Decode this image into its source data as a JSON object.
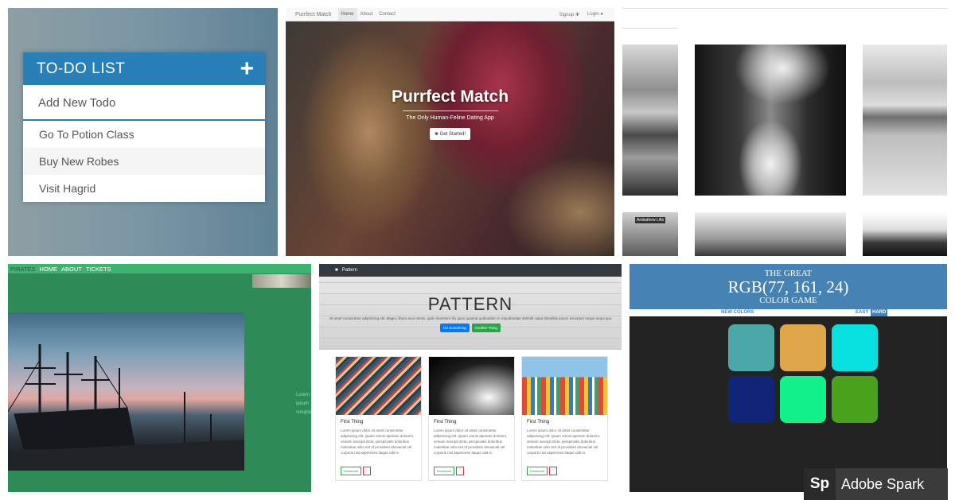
{
  "todo": {
    "title": "TO-DO LIST",
    "add_icon": "+",
    "new_placeholder": "Add New Todo",
    "items": [
      "Go To Potion Class",
      "Buy New Robes",
      "Visit Hagrid"
    ],
    "accent": "#2980b9"
  },
  "purrfect": {
    "brand": "Purrfect Match",
    "nav": [
      "Home",
      "About",
      "Contact"
    ],
    "signup": "Signup",
    "login": "Login",
    "title": "Purrfect Match",
    "subtitle": "The Only Human-Feline Dating App",
    "cta": "Get Started!"
  },
  "gallery": {
    "sign_text": "Ambathew Lifts"
  },
  "pirates": {
    "nav": [
      "PIRATES",
      "HOME",
      "ABOUT",
      "TICKETS"
    ],
    "side_text": [
      "Lorem",
      "ipsum",
      "volupta"
    ],
    "bg": "#2e8b57"
  },
  "pattern": {
    "brand": "Pattern",
    "title": "PATTERN",
    "lead": "sit amet consectetur adipisicing elit. Magni, libero eius omnis, optio inventore illo quos quaerat quibusdam in repudiandae deleniti culpa blanditiis ipsum excepturi neque sequi quo",
    "btn_primary": "Do Something",
    "btn_secondary": "Another Thing",
    "cards": [
      {
        "title": "First Thing",
        "text": "Lorem ipsum dolor sit amet consectetur adipisicing elit. Quam omnis aperiam dolorem, veniam suscipit dicta, perspiciatis doloribus molestiae odio sint id provident obcaecati vel corporis nisi asperiores itaque odit in.",
        "download": "Download",
        "heart": "♡"
      },
      {
        "title": "First Thing",
        "text": "Lorem ipsum dolor sit amet consectetur adipisicing elit. Quam omnis aperiam dolorem, veniam suscipit dicta, perspiciatis doloribus molestiae odio sint id provident obcaecati vel corporis nisi asperiores itaque odit in.",
        "download": "Download",
        "heart": "♡"
      },
      {
        "title": "First Thing",
        "text": "Lorem ipsum dolor sit amet consectetur adipisicing elit. Quam omnis aperiam dolorem, veniam suscipit dicta, perspiciatis doloribus molestiae odio sint id provident obcaecati vel corporis nisi asperiores itaque odit in.",
        "download": "Download",
        "heart": "♡"
      }
    ]
  },
  "rgb": {
    "line1": "THE GREAT",
    "line2": "RGB(77, 161, 24)",
    "line3": "COLOR GAME",
    "new_colors": "NEW COLORS",
    "easy": "EASY",
    "hard": "HARD",
    "header_bg": "#4682b4",
    "squares": [
      "#4ba8a8",
      "#e0a64a",
      "#08e0e0",
      "#102478",
      "#12f28c",
      "#4aa11c"
    ]
  },
  "watermark": {
    "logo": "Sp",
    "text": "Adobe Spark"
  }
}
